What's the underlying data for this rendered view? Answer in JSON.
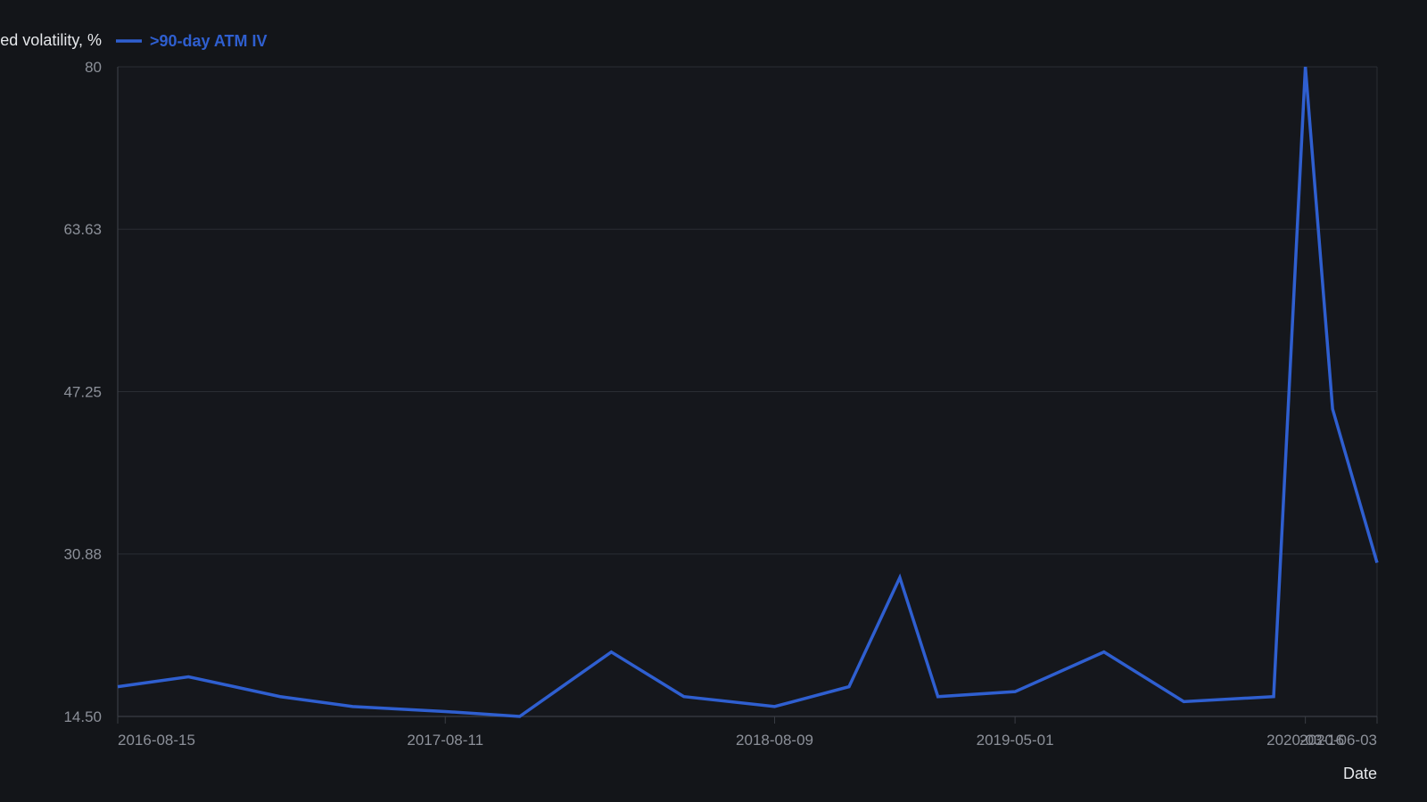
{
  "chart_data": {
    "type": "line",
    "title": "",
    "ylabel": "Implied volatility, %",
    "xlabel": "Date",
    "legend_position": "top-left",
    "grid": true,
    "ylim": [
      14.5,
      80
    ],
    "yticks": [
      14.5,
      30.88,
      47.25,
      63.63,
      80
    ],
    "ytick_labels": [
      "14.50",
      "30.88",
      "47.25",
      "63.63",
      "80"
    ],
    "xticks": [
      "2016-08-15",
      "2017-08-11",
      "2018-08-09",
      "2019-05-01",
      "2020-03-16",
      "2020-06-03"
    ],
    "series": [
      {
        "name": ">90-day ATM IV",
        "color": "#2f5fd0",
        "points": [
          [
            "2016-08-15",
            17.5
          ],
          [
            "2016-11-01",
            18.5
          ],
          [
            "2017-02-10",
            16.5
          ],
          [
            "2017-05-01",
            15.5
          ],
          [
            "2017-08-11",
            15.0
          ],
          [
            "2017-11-01",
            14.5
          ],
          [
            "2018-02-10",
            21.0
          ],
          [
            "2018-05-01",
            16.5
          ],
          [
            "2018-08-09",
            15.5
          ],
          [
            "2018-10-30",
            17.5
          ],
          [
            "2018-12-25",
            28.5
          ],
          [
            "2019-02-05",
            16.5
          ],
          [
            "2019-05-01",
            17.0
          ],
          [
            "2019-08-07",
            21.0
          ],
          [
            "2019-11-03",
            16.0
          ],
          [
            "2020-02-10",
            16.5
          ],
          [
            "2020-03-16",
            80.0
          ],
          [
            "2020-04-15",
            45.5
          ],
          [
            "2020-06-03",
            30.0
          ]
        ]
      }
    ]
  }
}
